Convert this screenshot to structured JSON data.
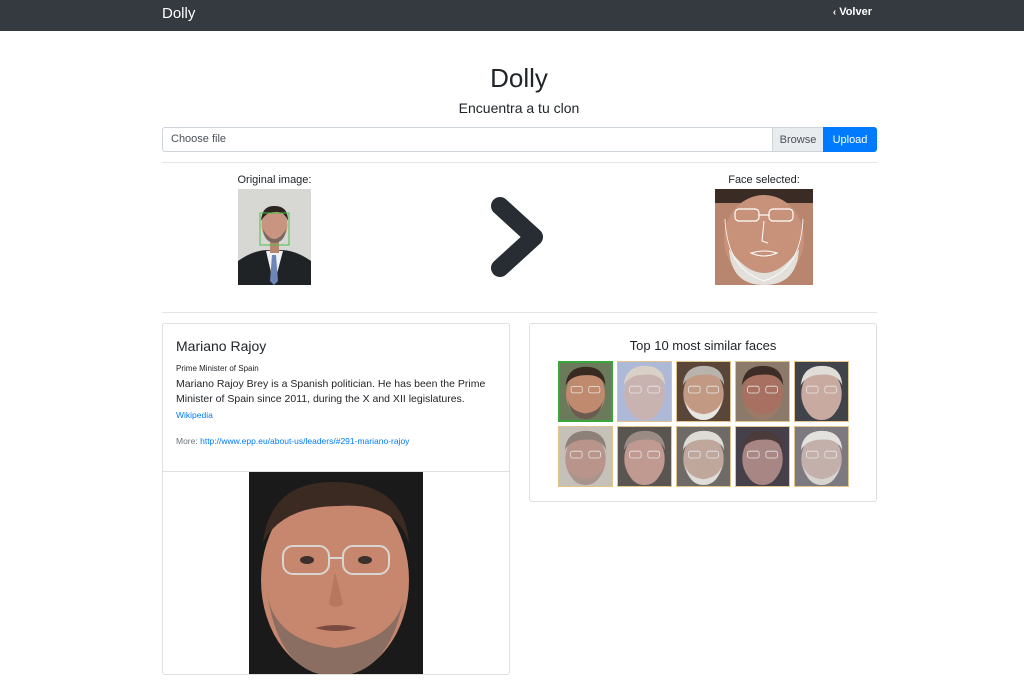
{
  "navbar": {
    "brand": "Dolly",
    "back_label": "Volver"
  },
  "header": {
    "title": "Dolly",
    "subtitle": "Encuentra a tu clon"
  },
  "upload": {
    "file_label": "Choose file",
    "browse_label": "Browse",
    "upload_label": "Upload"
  },
  "preview": {
    "original_caption": "Original image:",
    "selected_caption": "Face selected:",
    "arrow_icon": "chevron-right-icon"
  },
  "match": {
    "name": "Mariano Rajoy",
    "role": "Prime Minister of Spain",
    "description": "Mariano Rajoy Brey is a Spanish politician. He has been the Prime Minister of Spain since 2011, during the X and XII legislatures.",
    "wiki_label": "Wikipedia",
    "more_prefix": "More:",
    "more_url": "http://www.epp.eu/about-us/leaders/#291-mariano-rajoy"
  },
  "similar": {
    "title": "Top 10 most similar faces",
    "faces": [
      {
        "skin": "#c08a6e",
        "hair": "#3a2b22",
        "bg": "#6b7a5a",
        "beard": "#6a5a50",
        "selected": true
      },
      {
        "skin": "#c9b3b0",
        "hair": "#d9d0c8",
        "bg": "#aeb9d8",
        "beard": "#c9b3b0",
        "selected": false
      },
      {
        "skin": "#c29a84",
        "hair": "#b9b3ad",
        "bg": "#5a4638",
        "beard": "#e8e6e2",
        "selected": false
      },
      {
        "skin": "#a87060",
        "hair": "#3d2d27",
        "bg": "#8b7a6a",
        "beard": "#9a7a68",
        "selected": false
      },
      {
        "skin": "#c8aaa0",
        "hair": "#e0dcd8",
        "bg": "#40434a",
        "beard": "#c8aaa0",
        "selected": false
      },
      {
        "skin": "#b8948a",
        "hair": "#8d8079",
        "bg": "#c5c0b8",
        "beard": "#a8948a",
        "selected": false
      },
      {
        "skin": "#c09a90",
        "hair": "#9b8b85",
        "bg": "#5b5552",
        "beard": "#c09a90",
        "selected": false
      },
      {
        "skin": "#bfa79c",
        "hair": "#dedbd6",
        "bg": "#6e6a68",
        "beard": "#e0ddd8",
        "selected": false
      },
      {
        "skin": "#a88684",
        "hair": "#4b3b3b",
        "bg": "#45404a",
        "beard": "#a88684",
        "selected": false
      },
      {
        "skin": "#c4b0aa",
        "hair": "#e4e2de",
        "bg": "#7c7a80",
        "beard": "#d8d4d0",
        "selected": false
      }
    ]
  },
  "colors": {
    "navbar": "#343a40",
    "primary": "#007bff",
    "arrow": "#282c33"
  }
}
